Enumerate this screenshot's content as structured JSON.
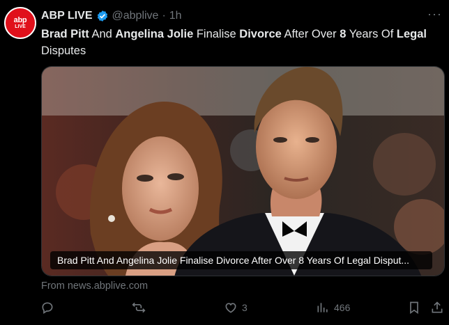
{
  "post": {
    "author_name": "ABP LIVE",
    "handle": "@abplive",
    "separator": "·",
    "time": "1h",
    "more": "···",
    "avatar_line1": "abp",
    "avatar_line2": "LIVE",
    "text_segments": [
      {
        "t": "Brad Pitt",
        "bold": true
      },
      {
        "t": " And ",
        "bold": false
      },
      {
        "t": "Angelina Jolie",
        "bold": true
      },
      {
        "t": " Finalise ",
        "bold": false
      },
      {
        "t": "Divorce",
        "bold": true
      },
      {
        "t": " After Over ",
        "bold": false
      },
      {
        "t": "8",
        "bold": true
      },
      {
        "t": " Years Of ",
        "bold": false
      },
      {
        "t": "Legal",
        "bold": true
      },
      {
        "t": " Disputes",
        "bold": false
      }
    ],
    "media_caption": "Brad Pitt And Angelina Jolie Finalise Divorce After Over 8 Years Of Legal Disput...",
    "source": "From news.abplive.com"
  },
  "actions": {
    "reply_count": "",
    "repost_count": "",
    "like_count": "3",
    "views_count": "466"
  },
  "icons": [
    "verified-badge-icon",
    "more-icon",
    "reply-icon",
    "repost-icon",
    "like-icon",
    "views-icon",
    "bookmark-icon",
    "share-icon"
  ],
  "colors": {
    "background": "#000000",
    "text": "#e7e9ea",
    "muted": "#71767b",
    "verified": "#1d9bf0",
    "avatar_red": "#e0101b"
  }
}
